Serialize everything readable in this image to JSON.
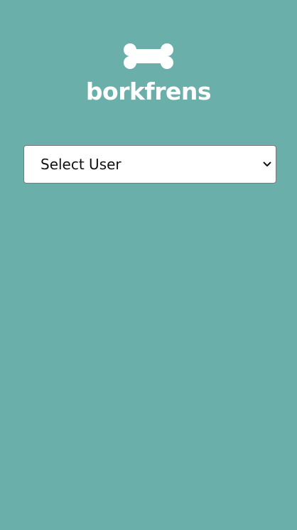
{
  "app": {
    "brand_name": "borkfrens",
    "logo_icon": "bone-icon"
  },
  "user_selector": {
    "selected_label": "Select User",
    "icon": "chevron-down-icon"
  },
  "colors": {
    "background": "#6aafa9",
    "logo": "#ffffff",
    "select_background": "#ffffff",
    "select_border": "#7a7a7a"
  }
}
